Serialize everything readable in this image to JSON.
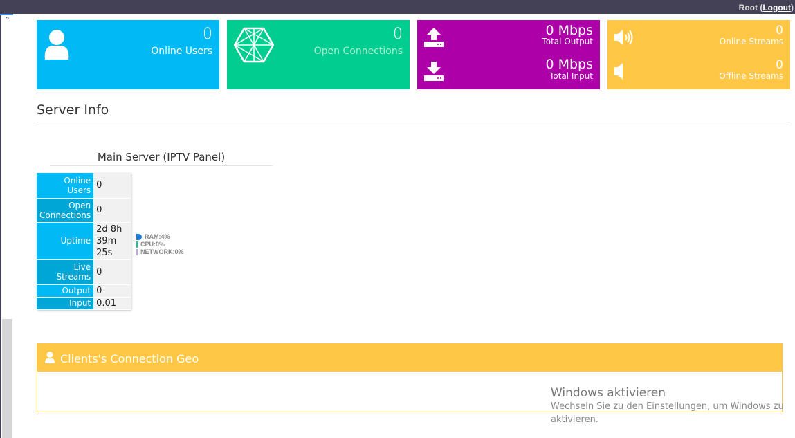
{
  "header": {
    "user": "Root",
    "logout": "Logout"
  },
  "tiles": {
    "online_users": {
      "value": "0",
      "label": "Online Users",
      "icon": "user-icon",
      "color": "#00b9f5"
    },
    "open_connections": {
      "value": "0",
      "label": "Open Connections",
      "icon": "network-hexagon-icon",
      "color": "#00cd8f"
    },
    "total_output": {
      "value": "0 Mbps",
      "label": "Total Output",
      "icon": "upload-icon",
      "color": "#ad00a8"
    },
    "total_input": {
      "value": "0 Mbps",
      "label": "Total Input",
      "icon": "download-icon"
    },
    "online_streams": {
      "value": "0",
      "label": "Online Streams",
      "icon": "volume-up-icon",
      "color": "#ffc745"
    },
    "offline_streams": {
      "value": "0",
      "label": "Offline Streams",
      "icon": "volume-off-icon"
    }
  },
  "server_info": {
    "title": "Server Info",
    "server_name": "Main Server (IPTV Panel)",
    "rows": [
      {
        "k": "Online Users",
        "v": "0"
      },
      {
        "k": "Open Connections",
        "v": "0"
      },
      {
        "k": "Uptime",
        "v": "2d 8h 39m 25s"
      },
      {
        "k": "Live Streams",
        "v": "0"
      },
      {
        "k": "Output",
        "v": "0"
      },
      {
        "k": "Input",
        "v": "0.01"
      }
    ],
    "legend": [
      {
        "label": "RAM:4%",
        "color": "#1a7fd6"
      },
      {
        "label": "CPU:0%",
        "color": "#00cd8f"
      },
      {
        "label": "NETWORK:0%",
        "color": "#b9a9e6"
      }
    ]
  },
  "geo": {
    "title": "Clients's Connection Geo",
    "icon": "user-icon"
  },
  "watermark": {
    "title": "Windows aktivieren",
    "text": "Wechseln Sie zu den Einstellungen, um Windows zu aktivieren."
  }
}
